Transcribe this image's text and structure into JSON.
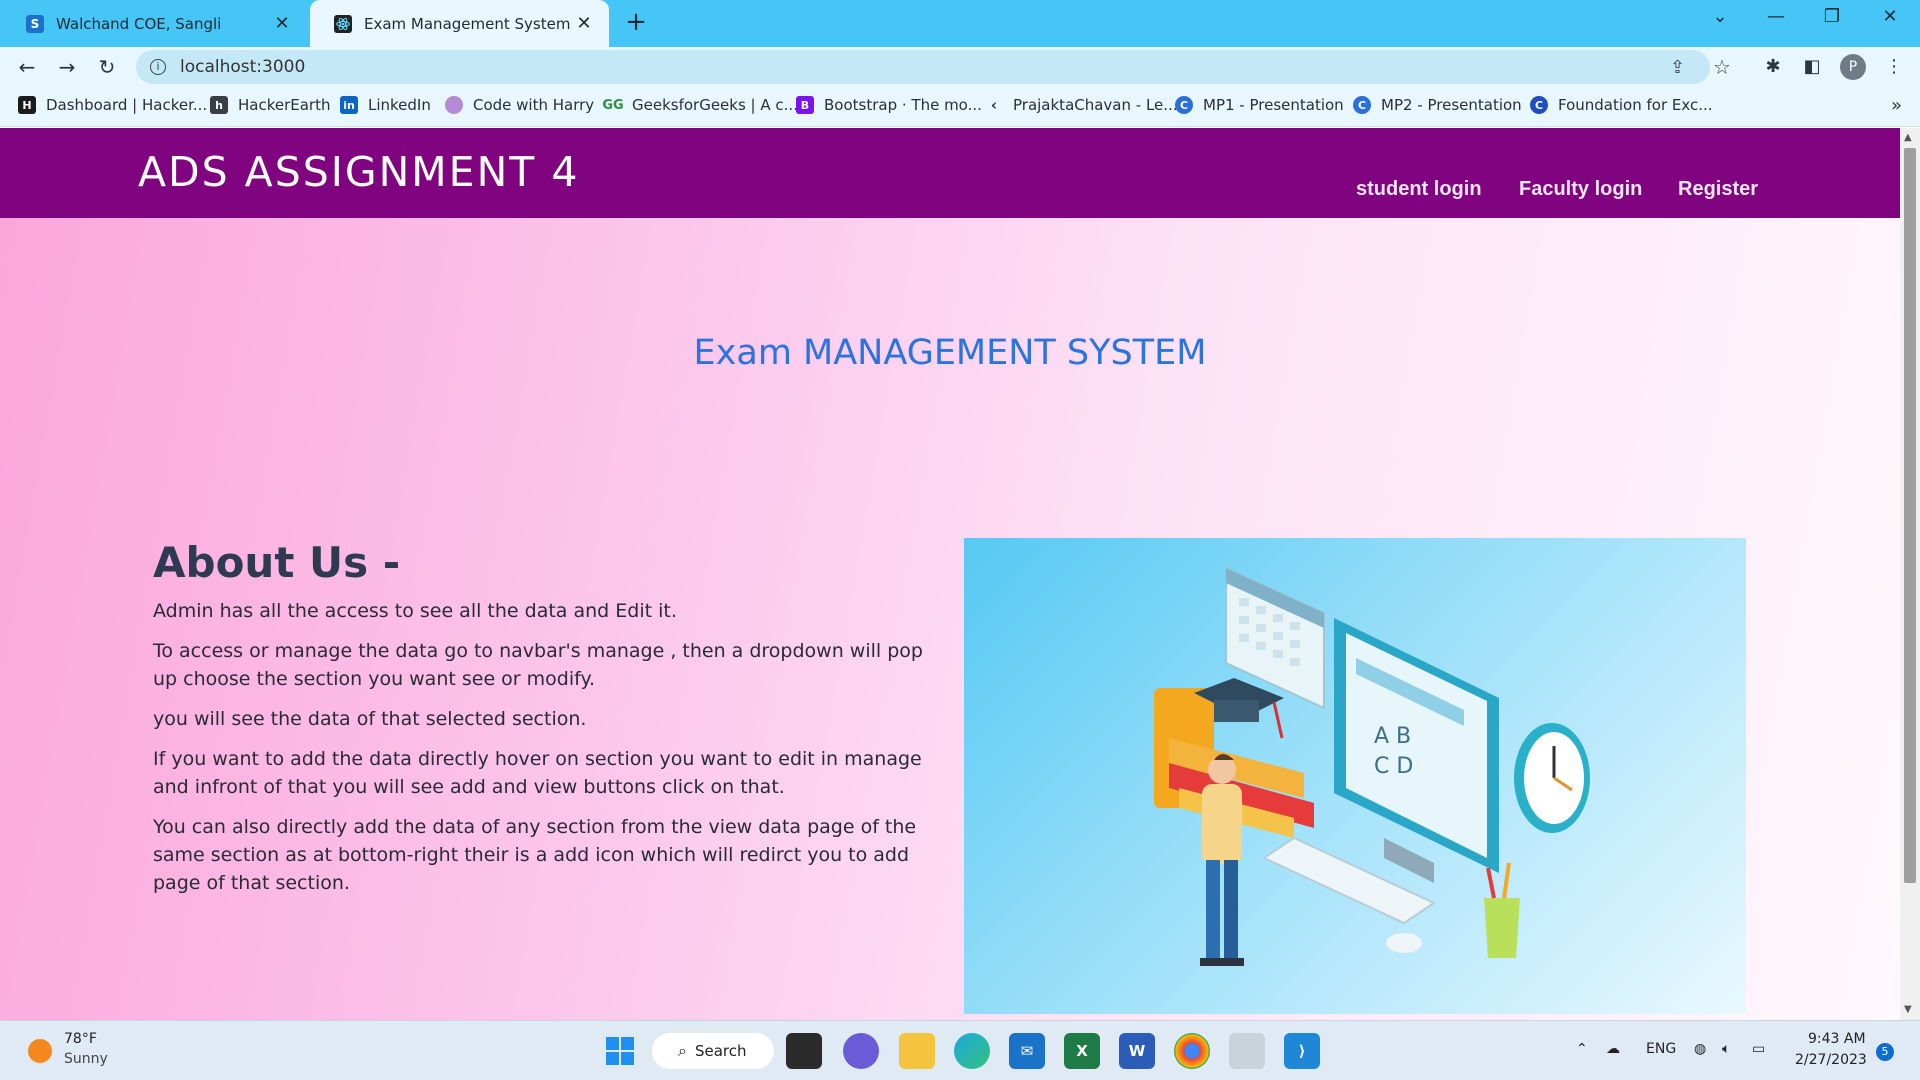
{
  "browser": {
    "tabs": [
      {
        "title": "Walchand COE, Sangli",
        "favicon": "S"
      },
      {
        "title": "Exam Management System"
      }
    ],
    "url": "localhost:3000",
    "profile_initial": "P",
    "bookmarks": [
      {
        "label": "Dashboard | Hacker..."
      },
      {
        "label": "HackerEarth"
      },
      {
        "label": "LinkedIn"
      },
      {
        "label": "Code with Harry"
      },
      {
        "label": "GeeksforGeeks | A c..."
      },
      {
        "label": "Bootstrap · The mo..."
      },
      {
        "label": "PrajaktaChavan - Le..."
      },
      {
        "label": "MP1 - Presentation"
      },
      {
        "label": "MP2 - Presentation"
      },
      {
        "label": "Foundation for Exc..."
      }
    ]
  },
  "page": {
    "brand": "ADS ASSIGNMENT 4",
    "nav": [
      "student login",
      "Faculty login",
      "Register"
    ],
    "hero_title": "Exam MANAGEMENT SYSTEM",
    "about": {
      "heading": "About Us -",
      "paragraphs": [
        "Admin has all the access to see all the data and Edit it.",
        "To access or manage the data go to navbar's manage , then a dropdown will pop up choose the section you want see or modify.",
        "you will see the data of that selected section.",
        "If you want to add the data directly hover on section you want to edit in manage and infront of that you will see add and view buttons click on that.",
        "You can also directly add the data of any section from the view data page of the same section as at bottom-right their is a add icon which will redirct you to add page of that section."
      ]
    },
    "colors": {
      "navbar": "#80037f",
      "hero_title": "#2b73df"
    }
  },
  "taskbar": {
    "weather_temp": "78°F",
    "weather_desc": "Sunny",
    "search_label": "Search",
    "language": "ENG",
    "time": "9:43 AM",
    "date": "2/27/2023",
    "notification_count": "5"
  }
}
